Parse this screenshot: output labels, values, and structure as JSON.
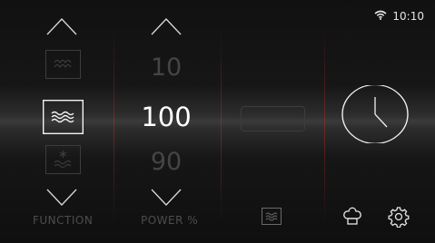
{
  "status": {
    "wifi_icon": "wifi-icon",
    "time": "10:10"
  },
  "function": {
    "label": "FUNCTION",
    "items": [
      {
        "icon": "steam-icon",
        "state": "dimmed"
      },
      {
        "icon": "convection-heat-icon",
        "state": "selected"
      },
      {
        "icon": "defrost-icon",
        "state": "dimmed"
      }
    ]
  },
  "power": {
    "label": "POWER %",
    "values": [
      "10",
      "100",
      "90"
    ],
    "selected": "100"
  },
  "bottom_icons": {
    "mode_icon": "heat-waves-icon",
    "chef_icon": "chef-hat-icon",
    "settings_icon": "gear-icon"
  },
  "colors": {
    "accent_divider": "#aa2828",
    "text_primary": "#ffffff",
    "text_dim": "#4d4d4d"
  }
}
